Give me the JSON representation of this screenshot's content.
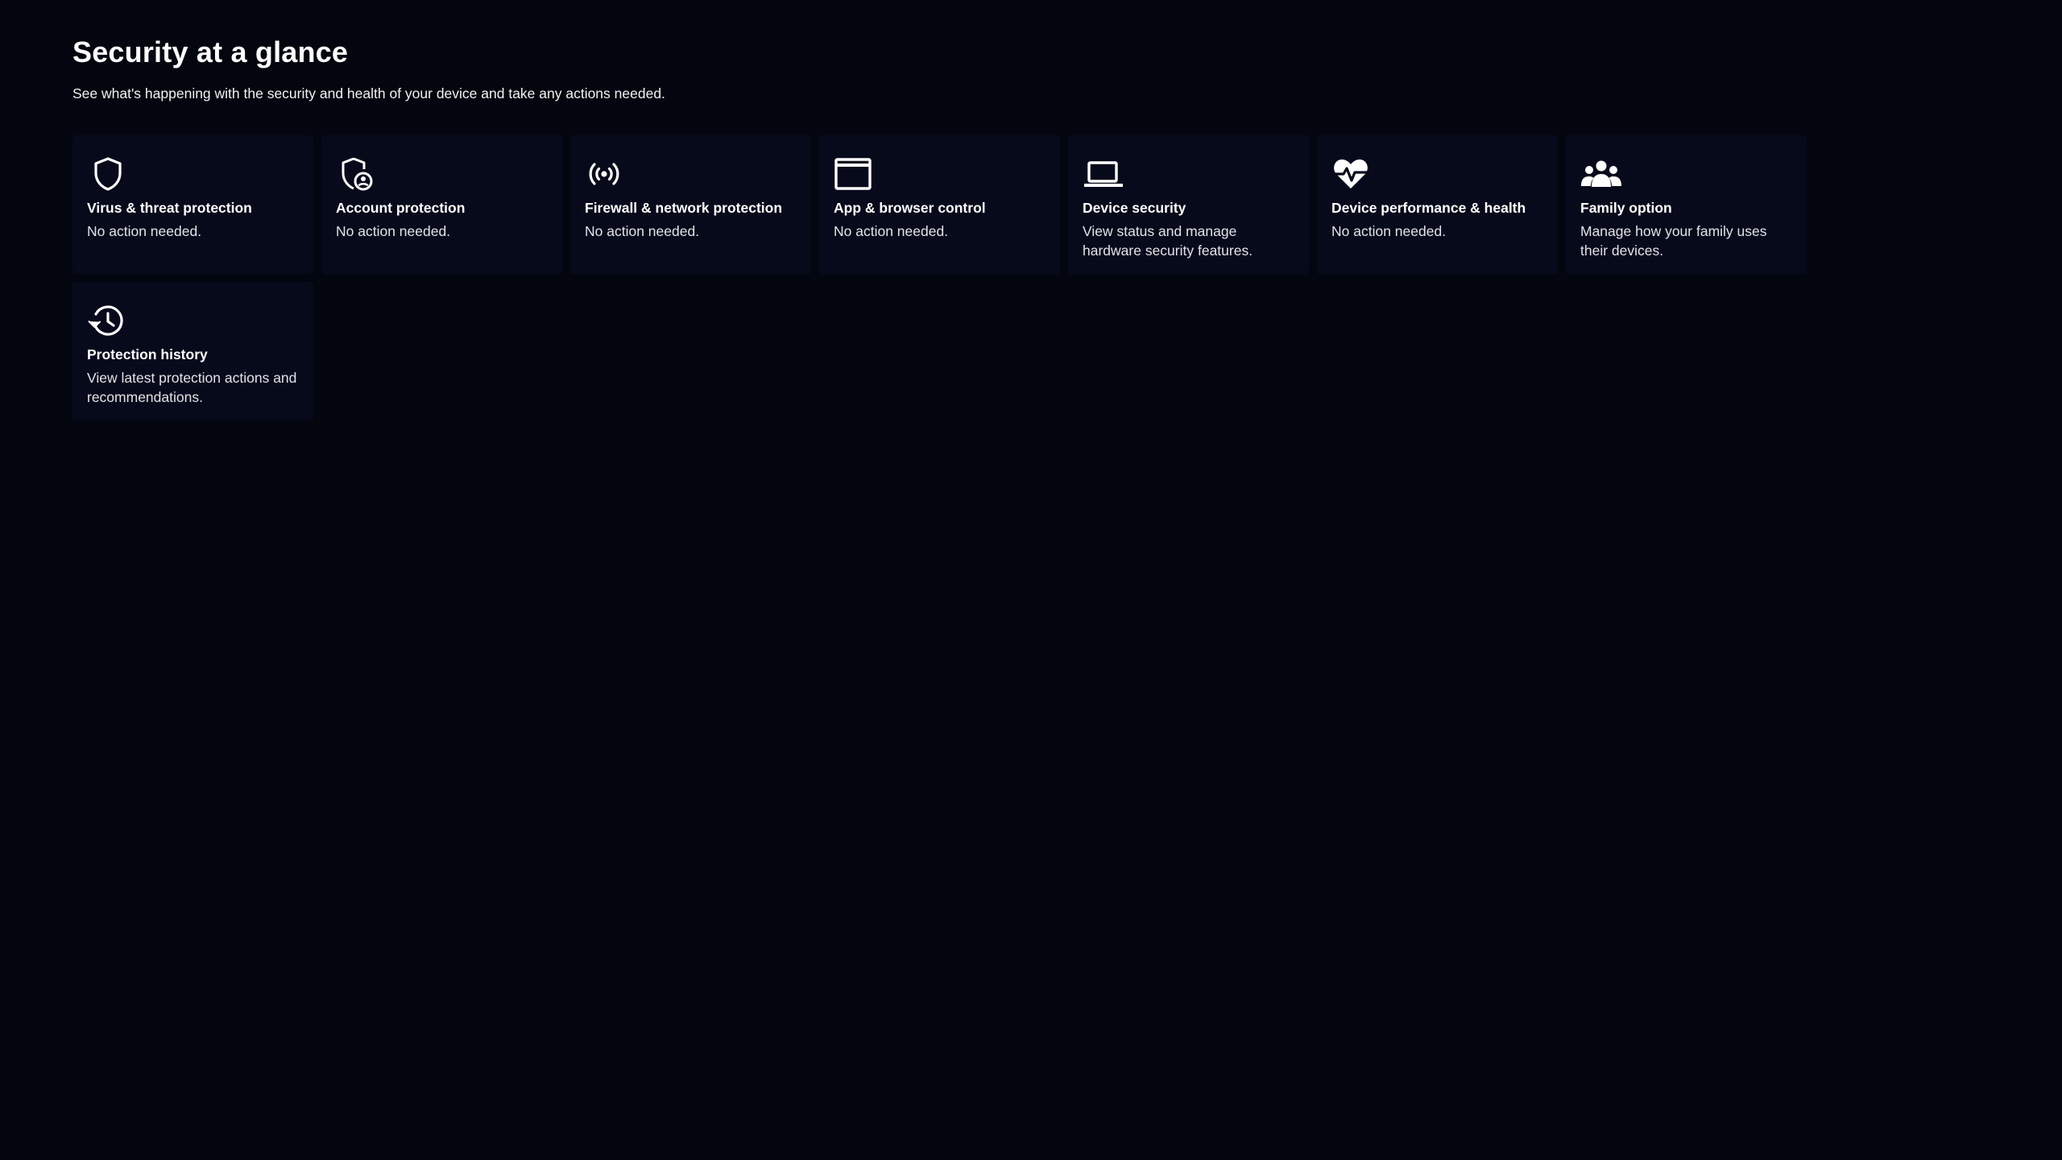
{
  "header": {
    "title": "Security at a glance",
    "subtitle": "See what's happening with the security and health of your device and take any actions needed."
  },
  "tiles": [
    {
      "icon": "shield-icon",
      "title": "Virus & threat protection",
      "description": "No action needed."
    },
    {
      "icon": "account-shield-icon",
      "title": "Account protection",
      "description": "No action needed."
    },
    {
      "icon": "wireless-broadcast-icon",
      "title": "Firewall & network protection",
      "description": "No action needed."
    },
    {
      "icon": "browser-window-icon",
      "title": "App & browser control",
      "description": "No action needed."
    },
    {
      "icon": "laptop-icon",
      "title": "Device security",
      "description": "View status and manage hardware security features."
    },
    {
      "icon": "heart-pulse-icon",
      "title": "Device performance & health",
      "description": "No action needed."
    },
    {
      "icon": "family-icon",
      "title": "Family option",
      "description": "Manage how your family uses their devices."
    },
    {
      "icon": "history-icon",
      "title": "Protection history",
      "description": "View latest protection actions and recommendations."
    }
  ],
  "colors": {
    "background": "#03060f",
    "tile": "#070a1b",
    "text": "#ffffff"
  }
}
